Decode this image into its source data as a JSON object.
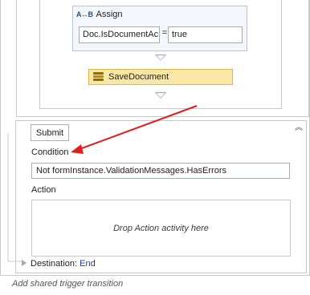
{
  "assign": {
    "title": "Assign",
    "icon": "assign-icon",
    "icon_text": "A↔B",
    "to": "Doc.IsDocumentAc",
    "operator": "=",
    "value": "true"
  },
  "save_document": {
    "label": "SaveDocument",
    "icon": "invoke-method-icon"
  },
  "transition": {
    "trigger": "Submit",
    "collapse_icon": "double-chevron-up-icon",
    "collapse_glyph": "︽",
    "condition_label": "Condition",
    "condition_value": "Not formInstance.ValidationMessages.HasErrors",
    "action_label": "Action",
    "action_placeholder": "Drop Action activity here"
  },
  "destination": {
    "label": "Destination:",
    "value": "End"
  },
  "footer": {
    "shared_trigger": "Add shared trigger transition"
  },
  "colors": {
    "annotation_arrow": "#e01e1e",
    "save_activity_fill": "#fbe8a6",
    "assign_fill": "#f3f6fa",
    "destination_link": "#1a3d99"
  }
}
